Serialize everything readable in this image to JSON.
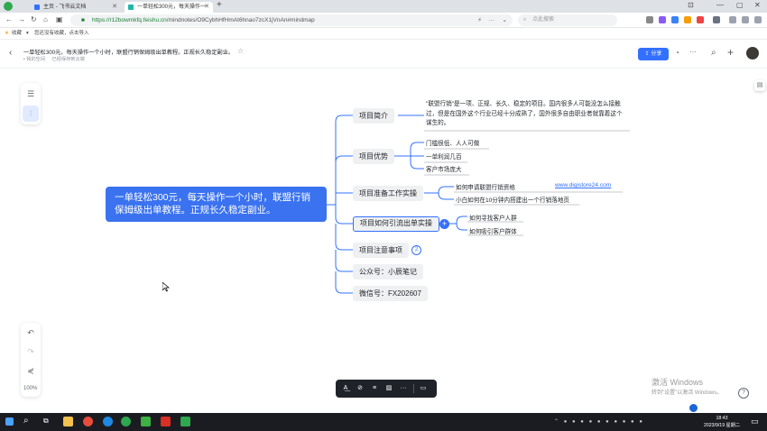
{
  "browser": {
    "tabs": [
      {
        "label": "主页 - 飞书云文档"
      },
      {
        "label": "一单轻松300元，每天操作一"
      }
    ],
    "url_host": "https://r12bowmkfq.feishu.cn",
    "url_path": "/mindnotes/O9CybhHfHmAt6hnao7zcX1jVnAn#mindmap",
    "search_placeholder": "点此搜索",
    "bookmarks": [
      "收藏",
      "导入"
    ],
    "bookmark_hint": "您还没有收藏，点击导入"
  },
  "doc": {
    "title": "一单轻松300元，每天操作一个小时，联盟行销保姆级出单教程。正规长久稳定副业。",
    "location": "我的空间",
    "status": "已经保存到云端",
    "share_label": "分享",
    "zoom": "100%"
  },
  "mindmap": {
    "root": "一单轻松300元，每天操作一个小时，联盟行销保姆级出单教程。正规长久稳定副业。",
    "branches": [
      {
        "label": "项目简介"
      },
      {
        "label": "项目优势"
      },
      {
        "label": "项目准备工作实操"
      },
      {
        "label": "项目如何引流出单实操"
      },
      {
        "label": "项目注意事项"
      },
      {
        "label": "公众号：小辰笔记"
      },
      {
        "label": "微信号：FX202607"
      }
    ],
    "intro_text": "\"联盟行销\"是一项、正规、长久、稳定的项目。国内很多人可能没怎么接触过，但是在国外这个行业已经十分成熟了，国外很多自由职业者就靠着这个谋生的。",
    "advantages": [
      "门槛很低、人人可做",
      "一单利润几百",
      "客户市场庞大"
    ],
    "prep": [
      "如何申请联盟行销资格",
      "小白如何在10分钟内搭建出一个行销落地页"
    ],
    "prep_link": "www.digistore24.com",
    "traffic": [
      "如何寻找客户人群",
      "如何吸引客户群体"
    ],
    "notes_count": "2"
  },
  "system": {
    "watermark_title": "激活 Windows",
    "watermark_sub": "转到\"设置\"以激活 Windows。",
    "time": "18:43",
    "date": "2023/9/19 星期二"
  },
  "colors": {
    "accent": "#3370ff",
    "root": "#3a72f0"
  }
}
